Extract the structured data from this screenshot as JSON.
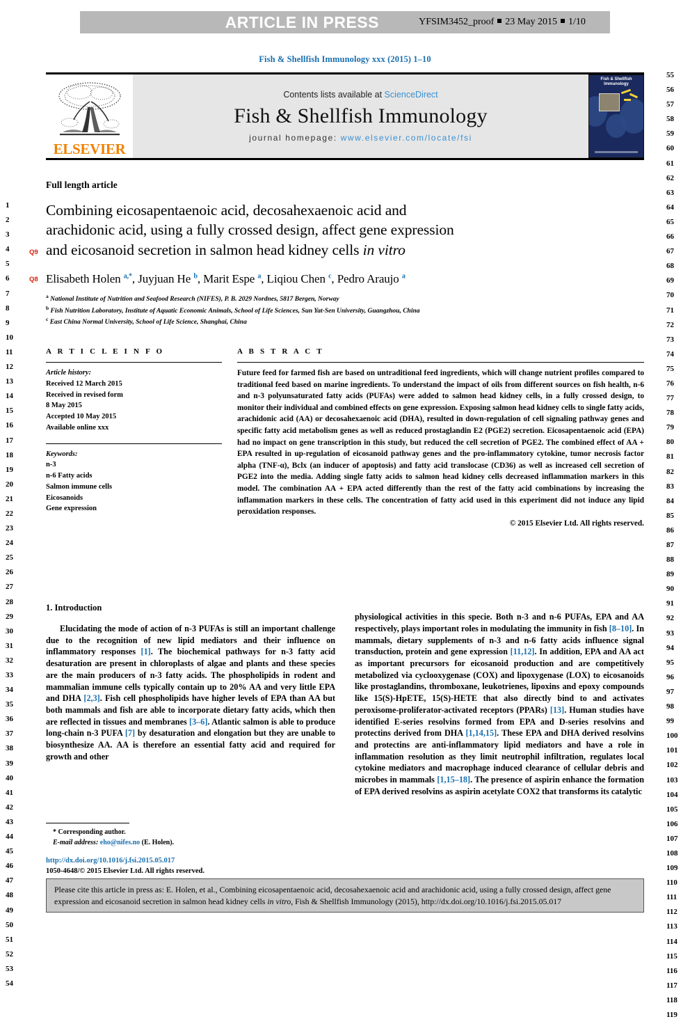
{
  "banner": {
    "article_in_press": "ARTICLE IN PRESS",
    "proof_id": "YFSIM3452_proof",
    "proof_date": "23 May 2015",
    "proof_page": "1/10"
  },
  "journal_line": "Fish & Shellfish Immunology xxx (2015) 1–10",
  "masthead": {
    "publisher": "ELSEVIER",
    "contents_prefix": "Contents lists available at ",
    "contents_link": "ScienceDirect",
    "journal_title": "Fish & Shellfish Immunology",
    "homepage_prefix": "journal homepage: ",
    "homepage_url": "www.elsevier.com/locate/fsi",
    "cover_title": "Fish & Shellfish Immunology"
  },
  "article": {
    "type_label": "Full length article",
    "title_line1": "Combining eicosapentaenoic acid, decosahexaenoic acid and",
    "title_line2": "arachidonic acid, using a fully crossed design, affect gene expression",
    "title_line3_a": "and eicosanoid secretion in salmon head kidney cells ",
    "title_line3_italic": "in vitro",
    "authors": "Elisabeth Holen a,*, Juyjuan He b, Marit Espe a, Liqiou Chen c, Pedro Araujo a",
    "affiliations": [
      "National Institute of Nutrition and Seafood Research (NIFES), P. B. 2029 Nordnes, 5817 Bergen, Norway",
      "Fish Nutrition Laboratory, Institute of Aquatic Economic Animals, School of Life Sciences, Sun Yat-Sen University, Guangzhou, China",
      "East China Normal University, School of Life Science, Shanghai, China"
    ],
    "affil_marks": [
      "a",
      "b",
      "c"
    ],
    "query_markers": [
      "Q9",
      "Q8"
    ]
  },
  "article_info": {
    "heading": "A R T I C L E  I N F O",
    "history_label": "Article history:",
    "history": [
      "Received 12 March 2015",
      "Received in revised form",
      "8 May 2015",
      "Accepted 10 May 2015",
      "Available online xxx"
    ],
    "keywords_label": "Keywords:",
    "keywords": [
      "n-3",
      "n-6 Fatty acids",
      "Salmon immune cells",
      "Eicosanoids",
      "Gene expression"
    ]
  },
  "abstract": {
    "heading": "A B S T R A C T",
    "text": "Future feed for farmed fish are based on untraditional feed ingredients, which will change nutrient profiles compared to traditional feed based on marine ingredients. To understand the impact of oils from different sources on fish health, n-6 and n-3 polyunsaturated fatty acids (PUFAs) were added to salmon head kidney cells, in a fully crossed design, to monitor their individual and combined effects on gene expression. Exposing salmon head kidney cells to single fatty acids, arachidonic acid (AA) or decosahexaenoic acid (DHA), resulted in down-regulation of cell signaling pathway genes and specific fatty acid metabolism genes as well as reduced prostaglandin E2 (PGE2) secretion. Eicosapentaenoic acid (EPA) had no impact on gene transcription in this study, but reduced the cell secretion of PGE2. The combined effect of AA + EPA resulted in up-regulation of eicosanoid pathway genes and the pro-inflammatory cytokine, tumor necrosis factor alpha (TNF-α), Bclx (an inducer of apoptosis) and fatty acid translocase (CD36) as well as increased cell secretion of PGE2 into the media. Adding single fatty acids to salmon head kidney cells decreased inflammation markers in this model. The combination AA + EPA acted differently than the rest of the fatty acid combinations by increasing the inflammation markers in these cells. The concentration of fatty acid used in this experiment did not induce any lipid peroxidation responses.",
    "copyright": "© 2015 Elsevier Ltd. All rights reserved."
  },
  "introduction": {
    "section_number_title": "1.  Introduction",
    "left_paragraph": "Elucidating the mode of action of n-3 PUFAs is still an important challenge due to the recognition of new lipid mediators and their influence on inflammatory responses [1]. The biochemical pathways for n-3 fatty acid desaturation are present in chloroplasts of algae and plants and these species are the main producers of n-3 fatty acids. The phospholipids in rodent and mammalian immune cells typically contain up to 20% AA and very little EPA and DHA [2,3]. Fish cell phospholipids have higher levels of EPA than AA but both mammals and fish are able to incorporate dietary fatty acids, which then are reflected in tissues and membranes [3–6]. Atlantic salmon is able to produce long-chain n-3 PUFA [7] by desaturation and elongation but they are unable to biosynthesize AA. AA is therefore an essential fatty acid and required for growth and other",
    "right_paragraph": "physiological activities in this specie. Both n-3 and n-6 PUFAs, EPA and AA respectively, plays important roles in modulating the immunity in fish [8–10]. In mammals, dietary supplements of n-3 and n-6 fatty acids influence signal transduction, protein and gene expression [11,12]. In addition, EPA and AA act as important precursors for eicosanoid production and are competitively metabolized via cyclooxygenase (COX) and lipoxygenase (LOX) to eicosanoids like prostaglandins, thromboxane, leukotrienes, lipoxins and epoxy compounds like 15(S)-HpETE, 15(S)-HETE that also directly bind to and activates peroxisome-proliferator-activated receptors (PPARs) [13]. Human studies have identified E-series resolvins formed from EPA and D-series resolvins and protectins derived from DHA [1,14,15]. These EPA and DHA derived resolvins and protectins are anti-inflammatory lipid mediators and have a role in inflammation resolution as they limit neutrophil infiltration, regulates local cytokine mediators and macrophage induced clearance of cellular debris and microbes in mammals [1,15–18]. The presence of aspirin enhance the formation of EPA derived resolvins as aspirin acetylate COX2 that transforms its catalytic"
  },
  "footnote": {
    "corresponding": "* Corresponding author.",
    "email_label": "E-mail address:",
    "email": "eho@nifes.no",
    "email_suffix": "(E. Holen)."
  },
  "doi_block": {
    "doi_url": "http://dx.doi.org/10.1016/j.fsi.2015.05.017",
    "issn_line": "1050-4648/© 2015 Elsevier Ltd. All rights reserved."
  },
  "cite_box": {
    "line1": "Please cite this article in press as: E. Holen, et al., Combining eicosapentaenoic acid, decosahexaenoic acid and arachidonic acid, using a fully",
    "line2_a": "crossed design, affect gene expression and eicosanoid secretion in salmon head kidney cells ",
    "line2_italic": "in vitro",
    "line2_b": ", Fish & Shellfish Immunology (2015),",
    "line3": "http://dx.doi.org/10.1016/j.fsi.2015.05.017"
  },
  "line_numbers": {
    "left_start": 1,
    "left_end": 54,
    "right_start": 55,
    "right_end": 119
  },
  "colors": {
    "link_blue": "#1a6faf",
    "sciencedirect_blue": "#3a8fd0",
    "elsevier_orange": "#f08000",
    "query_red": "#d81e05",
    "banner_gray": "#b8b8b8",
    "masthead_gray": "#e6e6e6",
    "cite_gray": "#c8c8c8"
  }
}
